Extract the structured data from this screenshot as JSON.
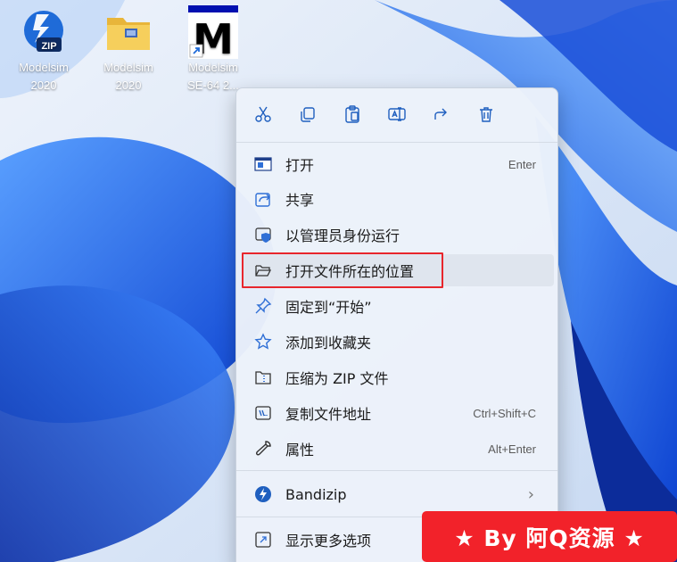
{
  "desktop": {
    "icons": [
      {
        "label": "Modelsim\n2020",
        "icon": "zip-archive-icon"
      },
      {
        "label": "Modelsim\n2020",
        "icon": "folder-icon"
      },
      {
        "label": "Modelsim\nSE-64 2...",
        "icon": "modelsim-shortcut-icon",
        "glyph": "M"
      }
    ]
  },
  "context_menu": {
    "toolbar": [
      {
        "name": "cut-button",
        "icon": "scissors-icon"
      },
      {
        "name": "copy-button",
        "icon": "copy-icon"
      },
      {
        "name": "paste-button",
        "icon": "paste-icon"
      },
      {
        "name": "rename-button",
        "icon": "rename-icon"
      },
      {
        "name": "share-button",
        "icon": "share-icon"
      },
      {
        "name": "delete-button",
        "icon": "trash-icon"
      }
    ],
    "items": [
      {
        "label": "打开",
        "accelerator": "Enter",
        "icon": "window-icon"
      },
      {
        "label": "共享",
        "accelerator": "",
        "icon": "share-icon"
      },
      {
        "label": "以管理员身份运行",
        "accelerator": "",
        "icon": "shield-icon"
      },
      {
        "label": "打开文件所在的位置",
        "accelerator": "",
        "icon": "folder-open-icon"
      },
      {
        "label": "固定到“开始”",
        "accelerator": "",
        "icon": "pin-icon"
      },
      {
        "label": "添加到收藏夹",
        "accelerator": "",
        "icon": "star-icon"
      },
      {
        "label": "压缩为 ZIP 文件",
        "accelerator": "",
        "icon": "zip-folder-icon"
      },
      {
        "label": "复制文件地址",
        "accelerator": "Ctrl+Shift+C",
        "icon": "copy-path-icon"
      },
      {
        "label": "属性",
        "accelerator": "Alt+Enter",
        "icon": "wrench-icon"
      }
    ],
    "submenu_item": {
      "label": "Bandizip",
      "icon": "bandizip-icon"
    },
    "more_item": {
      "label": "显示更多选项",
      "icon": "more-options-icon"
    }
  },
  "watermark": {
    "text": "★ By 阿Q资源 ★"
  },
  "colors": {
    "highlight": "#e8262c",
    "accent": "#2f6fd6",
    "badge": "#f2222a"
  }
}
